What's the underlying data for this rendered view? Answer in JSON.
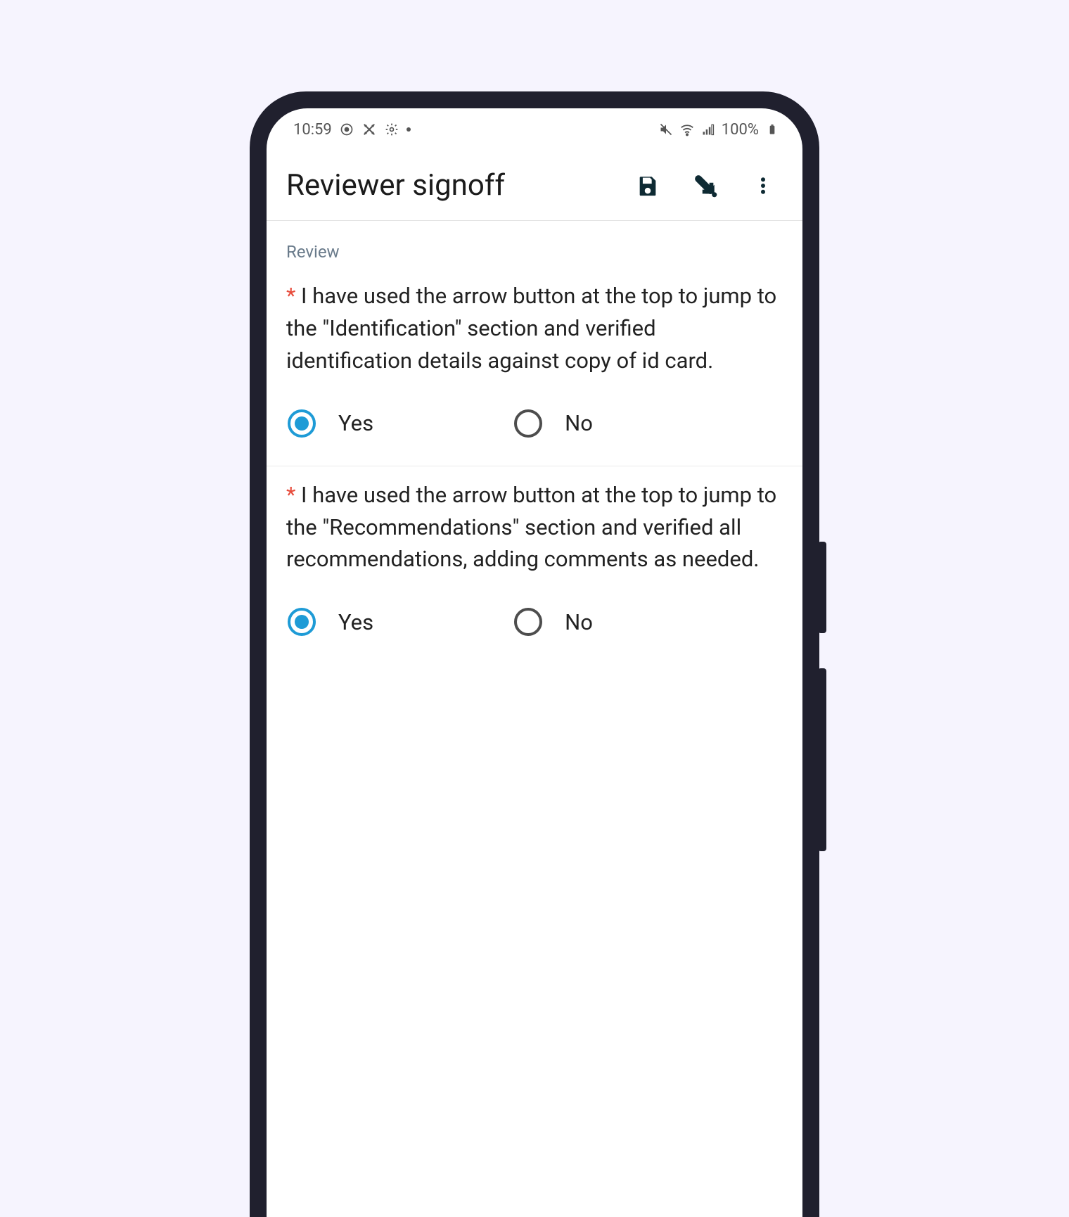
{
  "statusbar": {
    "time": "10:59",
    "battery_text": "100%"
  },
  "appbar": {
    "title": "Reviewer signoff"
  },
  "section": {
    "label": "Review"
  },
  "questions": [
    {
      "required_marker": "*",
      "text": " I have used the arrow button at the top to jump to the \"Identification\" section and verified identification details against copy of id card.",
      "options": {
        "yes": "Yes",
        "no": "No"
      },
      "selected": "yes"
    },
    {
      "required_marker": "*",
      "text": " I have used the arrow button at the top to jump to the \"Recommendations\" section and verified all recommendations, adding comments as needed.",
      "options": {
        "yes": "Yes",
        "no": "No"
      },
      "selected": "yes"
    }
  ]
}
